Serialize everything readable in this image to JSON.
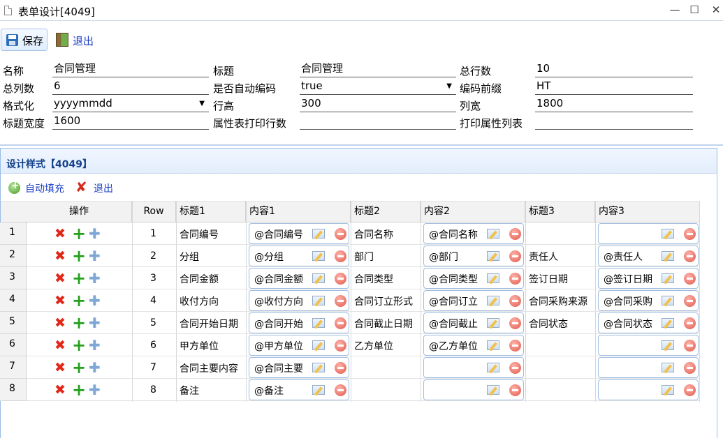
{
  "window": {
    "title": "表单设计[4049]",
    "min": "—",
    "max": "☐",
    "close": "✕"
  },
  "toolbar": {
    "save": "保存",
    "exit": "退出"
  },
  "form": {
    "name_label": "名称",
    "name": "合同管理",
    "title_label": "标题",
    "title": "合同管理",
    "rows_label": "总行数",
    "rows": "10",
    "cols_label": "总列数",
    "cols": "6",
    "autocode_label": "是否自动编码",
    "autocode": "true",
    "prefix_label": "编码前缀",
    "prefix": "HT",
    "format_label": "格式化",
    "format": "yyyymmdd",
    "rowheight_label": "行高",
    "rowheight": "300",
    "colwidth_label": "列宽",
    "colwidth": "1800",
    "titlewidth_label": "标题宽度",
    "titlewidth": "1600",
    "proprows_label": "属性表打印行数",
    "proprows": "",
    "proplist_label": "打印属性列表",
    "proplist": ""
  },
  "panel": {
    "title": "设计样式【4049】",
    "autofill": "自动填充",
    "exit": "退出"
  },
  "grid": {
    "headers": [
      "操作",
      "Row",
      "标题1",
      "内容1",
      "标题2",
      "内容2",
      "标题3",
      "内容3"
    ],
    "rows": [
      {
        "n": "1",
        "row": "1",
        "t1": "合同编号",
        "c1": "@合同编号",
        "t2": "合同名称",
        "c2": "@合同名称",
        "t3": "",
        "c3": ""
      },
      {
        "n": "2",
        "row": "2",
        "t1": "分组",
        "c1": "@分组",
        "t2": "部门",
        "c2": "@部门",
        "t3": "责任人",
        "c3": "@责任人"
      },
      {
        "n": "3",
        "row": "3",
        "t1": "合同金额",
        "c1": "@合同金额",
        "t2": "合同类型",
        "c2": "@合同类型",
        "t3": "签订日期",
        "c3": "@签订日期"
      },
      {
        "n": "4",
        "row": "4",
        "t1": "收付方向",
        "c1": "@收付方向",
        "t2": "合同订立形式",
        "c2": "@合同订立",
        "t3": "合同采购来源",
        "c3": "@合同采购"
      },
      {
        "n": "5",
        "row": "5",
        "t1": "合同开始日期",
        "c1": "@合同开始",
        "t2": "合同截止日期",
        "c2": "@合同截止",
        "t3": "合同状态",
        "c3": "@合同状态"
      },
      {
        "n": "6",
        "row": "6",
        "t1": "甲方单位",
        "c1": "@甲方单位",
        "t2": "乙方单位",
        "c2": "@乙方单位",
        "t3": "",
        "c3": ""
      },
      {
        "n": "7",
        "row": "7",
        "t1": "合同主要内容",
        "c1": "@合同主要",
        "t2": "",
        "c2": "",
        "t3": "",
        "c3": ""
      },
      {
        "n": "8",
        "row": "8",
        "t1": "备注",
        "c1": "@备注",
        "t2": "",
        "c2": "",
        "t3": "",
        "c3": ""
      }
    ]
  }
}
